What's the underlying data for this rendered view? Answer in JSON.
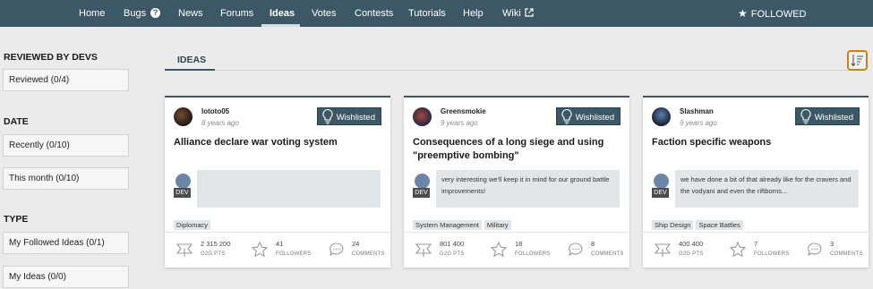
{
  "nav": {
    "home": "Home",
    "bugs": "Bugs",
    "news": "News",
    "forums": "Forums",
    "ideas": "Ideas",
    "votes": "Votes",
    "contests": "Contests",
    "tutorials": "Tutorials",
    "help": "Help",
    "wiki": "Wiki",
    "followed": "FOLLOWED",
    "icons": {
      "bugs": "help-icon",
      "wiki": "external-link-icon",
      "followed": "star-icon"
    }
  },
  "sidebar": {
    "reviewed_heading": "REVIEWED BY DEVS",
    "reviewed": "Reviewed (0/4)",
    "date_heading": "DATE",
    "recently": "Recently (0/10)",
    "this_month": "This month (0/10)",
    "type_heading": "TYPE",
    "followed_ideas": "My Followed Ideas (0/1)",
    "my_ideas": "My Ideas (0/0)"
  },
  "main": {
    "tab": "IDEAS",
    "sort_icon": "sort-icon"
  },
  "colors": {
    "nav_bg": "#3c5866",
    "accent": "#3c5866",
    "sort_border": "#c98218"
  },
  "cards": [
    {
      "author": "lototo05",
      "age": "8 years ago",
      "wishlisted": "Wishlisted",
      "title": "Alliance declare war voting system",
      "dev_badge": "DEV",
      "dev_comment": "",
      "tags": [
        "Diplomacy"
      ],
      "points": "2 315 200",
      "points_label": "G2G PTS",
      "followers": "41",
      "followers_label": "FOLLOWERS",
      "comments": "24",
      "comments_label": "COMMENTS"
    },
    {
      "author": "Greensmokie",
      "age": "9 years ago",
      "wishlisted": "Wishlisted",
      "title": "Consequences of a long siege and using \"preemptive bombing\"",
      "dev_badge": "DEV",
      "dev_comment": "very interesting we'll keep it in mind for our ground battle improvements!",
      "tags": [
        "System Management",
        "Military"
      ],
      "points": "801 400",
      "points_label": "G2G PTS",
      "followers": "18",
      "followers_label": "FOLLOWERS",
      "comments": "8",
      "comments_label": "COMMENTS"
    },
    {
      "author": "Slashman",
      "age": "9 years ago",
      "wishlisted": "Wishlisted",
      "title": "Faction specific weapons",
      "dev_badge": "DEV",
      "dev_comment": "we have done a bit of that already like for the cravers and the vodyani and even the riftborns...",
      "tags": [
        "Ship Design",
        "Space Battles"
      ],
      "points": "400 400",
      "points_label": "G2G PTS",
      "followers": "7",
      "followers_label": "FOLLOWERS",
      "comments": "3",
      "comments_label": "COMMENTS"
    }
  ]
}
